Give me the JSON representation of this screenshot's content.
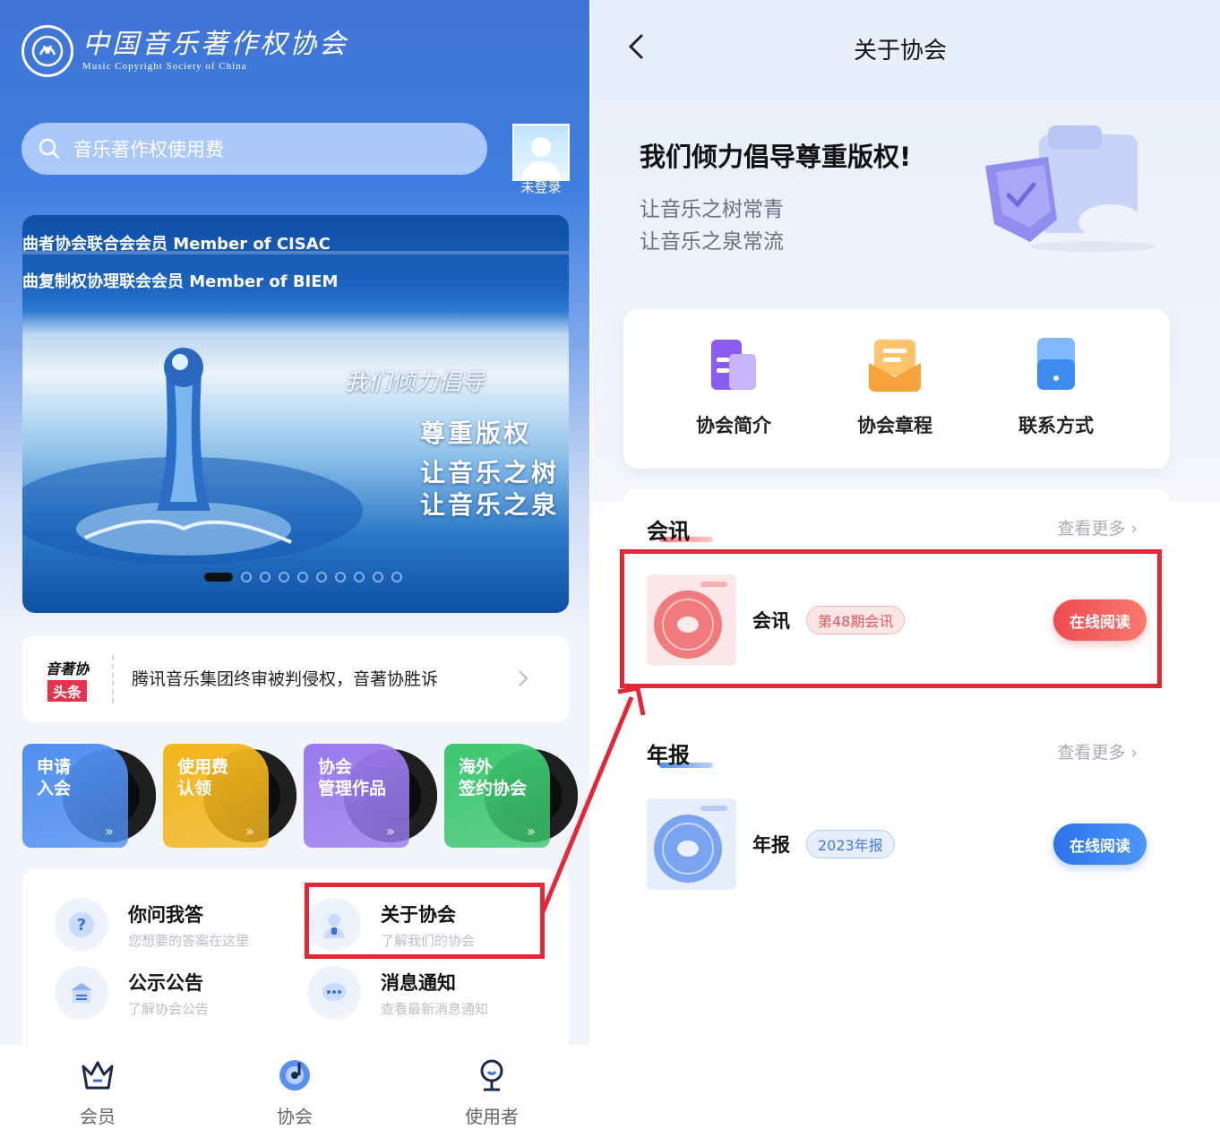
{
  "left": {
    "logo": {
      "cn": "中国音乐著作权协会",
      "en": "Music Copyright Society of China"
    },
    "search": {
      "placeholder": "音乐著作权使用费"
    },
    "avatar_label": "未登录",
    "banner": {
      "strip1": "曲者协会联合会会员 Member of CISAC",
      "strip2": "曲复制权协理联会会员 Member of BIEM",
      "slogan1": "我们倾力倡导",
      "slogan2": "尊重版权",
      "slogan3": "让音乐之树",
      "slogan4": "让音乐之泉",
      "dot_count": 10,
      "active_dot": 1
    },
    "news": {
      "badge_top": "音著协",
      "badge_bottom": "头条",
      "text": "腾讯音乐集团终审被判侵权，音著协胜诉"
    },
    "cards": [
      {
        "line1": "申请",
        "line2": "入会",
        "color": "#4f8ef0"
      },
      {
        "line1": "使用费",
        "line2": "认领",
        "color": "#f2b51c"
      },
      {
        "line1": "协会",
        "line2": "管理作品",
        "color": "#9a79ee"
      },
      {
        "line1": "海外",
        "line2": "签约协会",
        "color": "#3cc76f"
      }
    ],
    "grid": [
      {
        "title": "你问我答",
        "sub": "您想要的答案在这里",
        "icon": "question-icon"
      },
      {
        "title": "关于协会",
        "sub": "了解我们的协会",
        "icon": "person-info-icon"
      },
      {
        "title": "公示公告",
        "sub": "了解协会公告",
        "icon": "notice-icon"
      },
      {
        "title": "消息通知",
        "sub": "查看最新消息通知",
        "icon": "chat-bubble-icon"
      }
    ],
    "tabs": [
      {
        "label": "会员",
        "icon": "crown-icon"
      },
      {
        "label": "协会",
        "icon": "music-disc-icon"
      },
      {
        "label": "使用者",
        "icon": "user-icon"
      }
    ]
  },
  "right": {
    "title": "关于协会",
    "headline": "我们倾力倡导尊重版权!",
    "sub1": "让音乐之树常青",
    "sub2": "让音乐之泉常流",
    "quick": [
      {
        "label": "协会简介",
        "icon": "document-purple-icon",
        "color": "#8a5cf0"
      },
      {
        "label": "协会章程",
        "icon": "envelope-orange-icon",
        "color": "#f5a23a"
      },
      {
        "label": "联系方式",
        "icon": "contact-blue-icon",
        "color": "#3d8cf0"
      }
    ],
    "sections": [
      {
        "title": "会讯",
        "more": "查看更多",
        "item_name": "会讯",
        "tag": "第48期会讯",
        "button": "在线阅读",
        "accent": "#ef4e55"
      },
      {
        "title": "年报",
        "more": "查看更多",
        "item_name": "年报",
        "tag": "2023年报",
        "button": "在线阅读",
        "accent": "#2f7bf0"
      }
    ]
  },
  "colors": {
    "highlight_red": "#e42737",
    "brand_blue": "#3f74d6"
  }
}
